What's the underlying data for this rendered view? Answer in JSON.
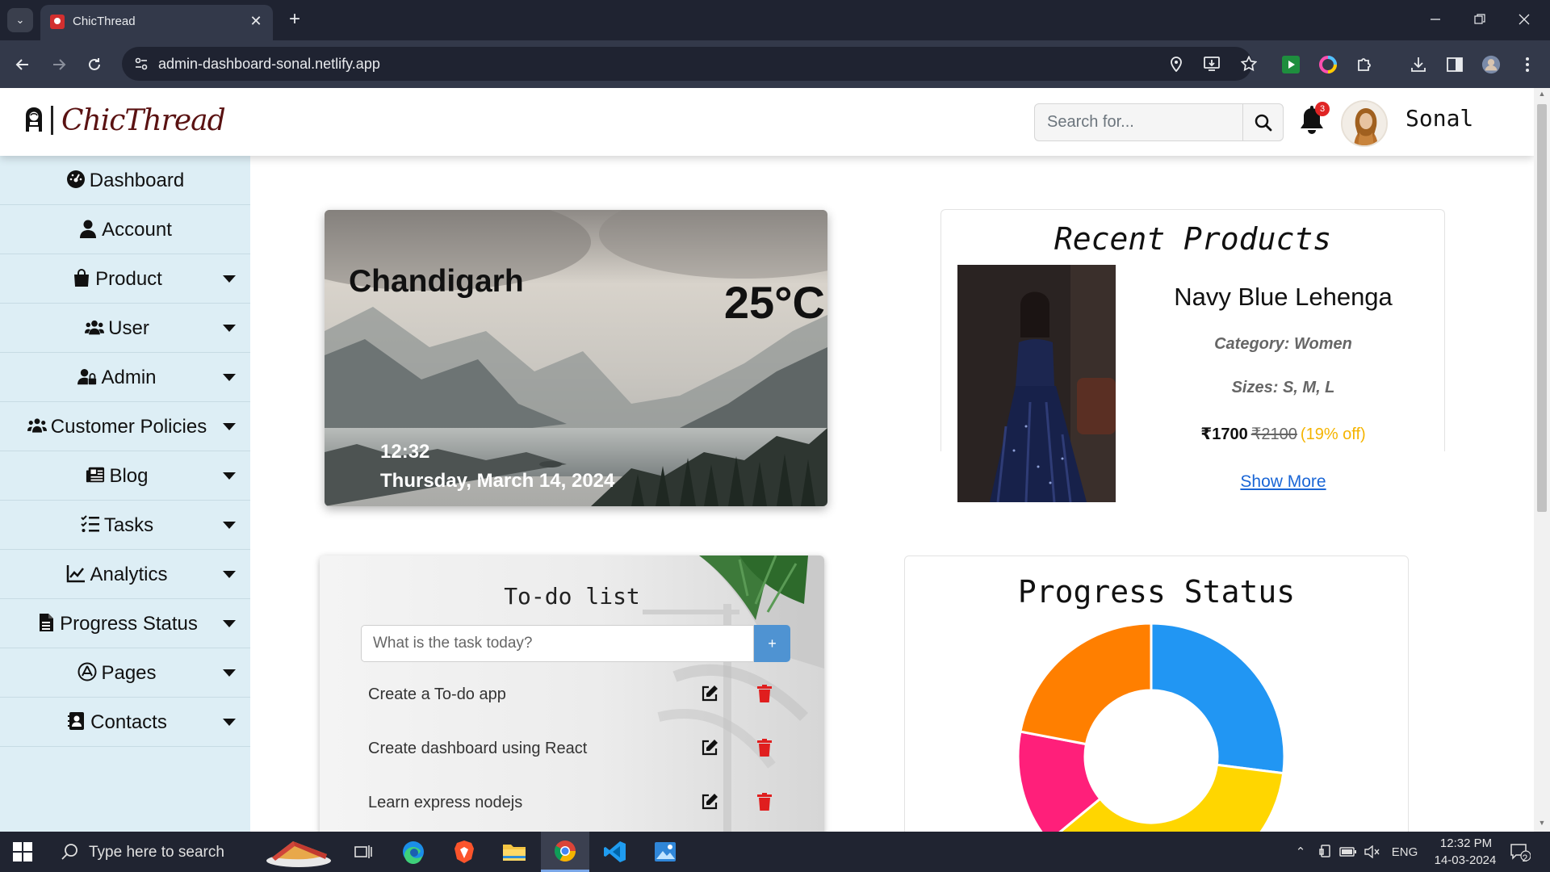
{
  "browser": {
    "tab_title": "ChicThread",
    "url": "admin-dashboard-sonal.netlify.app",
    "new_tab_label": "+",
    "close_tab_label": "✕"
  },
  "header": {
    "brand": "ChicThread",
    "search_placeholder": "Search for...",
    "notification_count": "3",
    "user_name": "Sonal"
  },
  "sidebar": {
    "items": [
      {
        "label": "Dashboard",
        "icon": "dashboard-gauge-icon"
      },
      {
        "label": "Account",
        "icon": "user-icon"
      },
      {
        "label": "Product",
        "icon": "shopping-bag-icon"
      },
      {
        "label": "User",
        "icon": "users-icon"
      },
      {
        "label": "Admin",
        "icon": "user-lock-icon"
      },
      {
        "label": "Customer Policies",
        "icon": "people-group-icon"
      },
      {
        "label": "Blog",
        "icon": "newspaper-icon"
      },
      {
        "label": "Tasks",
        "icon": "list-check-icon"
      },
      {
        "label": "Analytics",
        "icon": "line-chart-icon"
      },
      {
        "label": "Progress Status",
        "icon": "file-icon"
      },
      {
        "label": "Pages",
        "icon": "app-store-icon"
      },
      {
        "label": "Contacts",
        "icon": "address-book-icon"
      }
    ]
  },
  "weather": {
    "city": "Chandigarh",
    "temperature": "25°C",
    "time": "12:32",
    "date": "Thursday, March 14, 2024"
  },
  "recent_products": {
    "title": "Recent Products",
    "product_name": "Navy Blue Lehenga",
    "category": "Category: Women",
    "sizes": "Sizes: S, M, L",
    "price": "₹1700",
    "old_price": "₹2100",
    "discount": "(19% off)",
    "link": "Show More"
  },
  "todo": {
    "title": "To-do list",
    "placeholder": "What is the task today?",
    "add_label": "+",
    "items": [
      "Create a To-do app",
      "Create dashboard using React",
      "Learn express nodejs"
    ]
  },
  "progress": {
    "title": "Progress Status"
  },
  "chart_data": {
    "type": "pie",
    "slices": [
      {
        "color": "#2196f3",
        "value": 27
      },
      {
        "color": "#ffd600",
        "value": 37
      },
      {
        "color": "#ff1f7a",
        "value": 14
      },
      {
        "color": "#ff7f00",
        "value": 22
      }
    ],
    "donut": true
  },
  "taskbar": {
    "search_placeholder": "Type here to search",
    "language": "ENG",
    "time": "12:32 PM",
    "date": "14-03-2024",
    "notifications": "2"
  },
  "colors": {
    "sidebar_bg": "#ddeef5",
    "brand": "#5a1212",
    "accent": "#4f93d2"
  }
}
